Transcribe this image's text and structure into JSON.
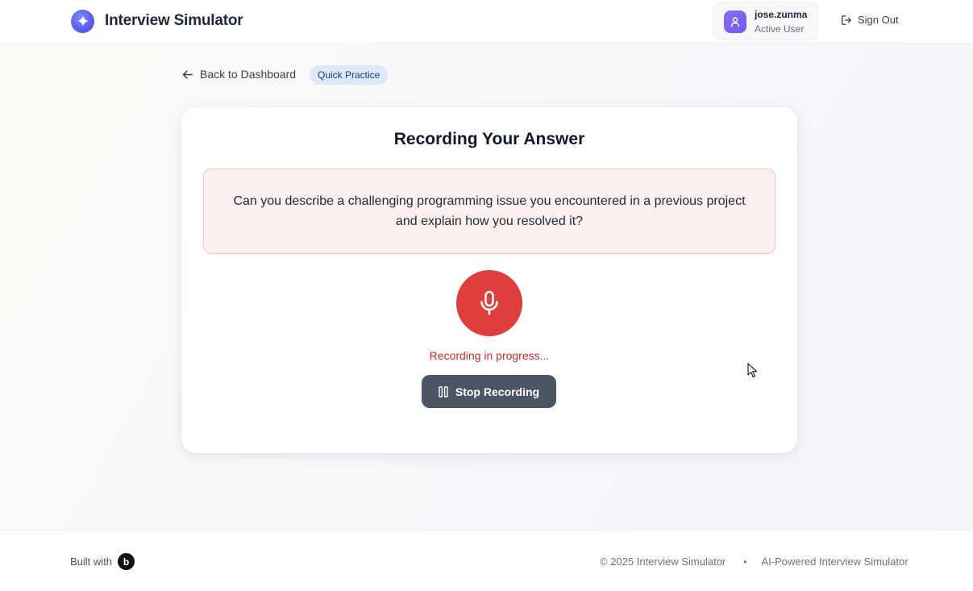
{
  "header": {
    "app_title": "Interview Simulator",
    "user": {
      "name": "jose.zunma",
      "role": "Active User"
    },
    "signout_label": "Sign Out"
  },
  "nav": {
    "back_label": "Back to Dashboard",
    "mode_badge": "Quick Practice"
  },
  "recording": {
    "title": "Recording Your Answer",
    "question": "Can you describe a challenging programming issue you encountered in a previous project and explain how you resolved it?",
    "status": "Recording in progress...",
    "stop_label": "Stop Recording"
  },
  "footer": {
    "built_with": "Built with",
    "built_logo_letter": "b",
    "copyright": "© 2025 Interview Simulator",
    "separator": "•",
    "tagline": "AI-Powered Interview Simulator"
  },
  "colors": {
    "brand": "#5b5ff0",
    "avatar": "#7c63f5",
    "record": "#e03d3d",
    "status": "#c42b2b",
    "question_bg": "#fdf0ef",
    "question_border": "#f4c6c4",
    "badge_bg": "#dce8fb",
    "stop_button": "#4b5563"
  },
  "icons": {
    "brand": "sparkle-icon",
    "avatar": "user-icon",
    "signout": "log-out-icon",
    "back": "arrow-left-icon",
    "record": "microphone-icon",
    "stop": "pause-icon"
  }
}
